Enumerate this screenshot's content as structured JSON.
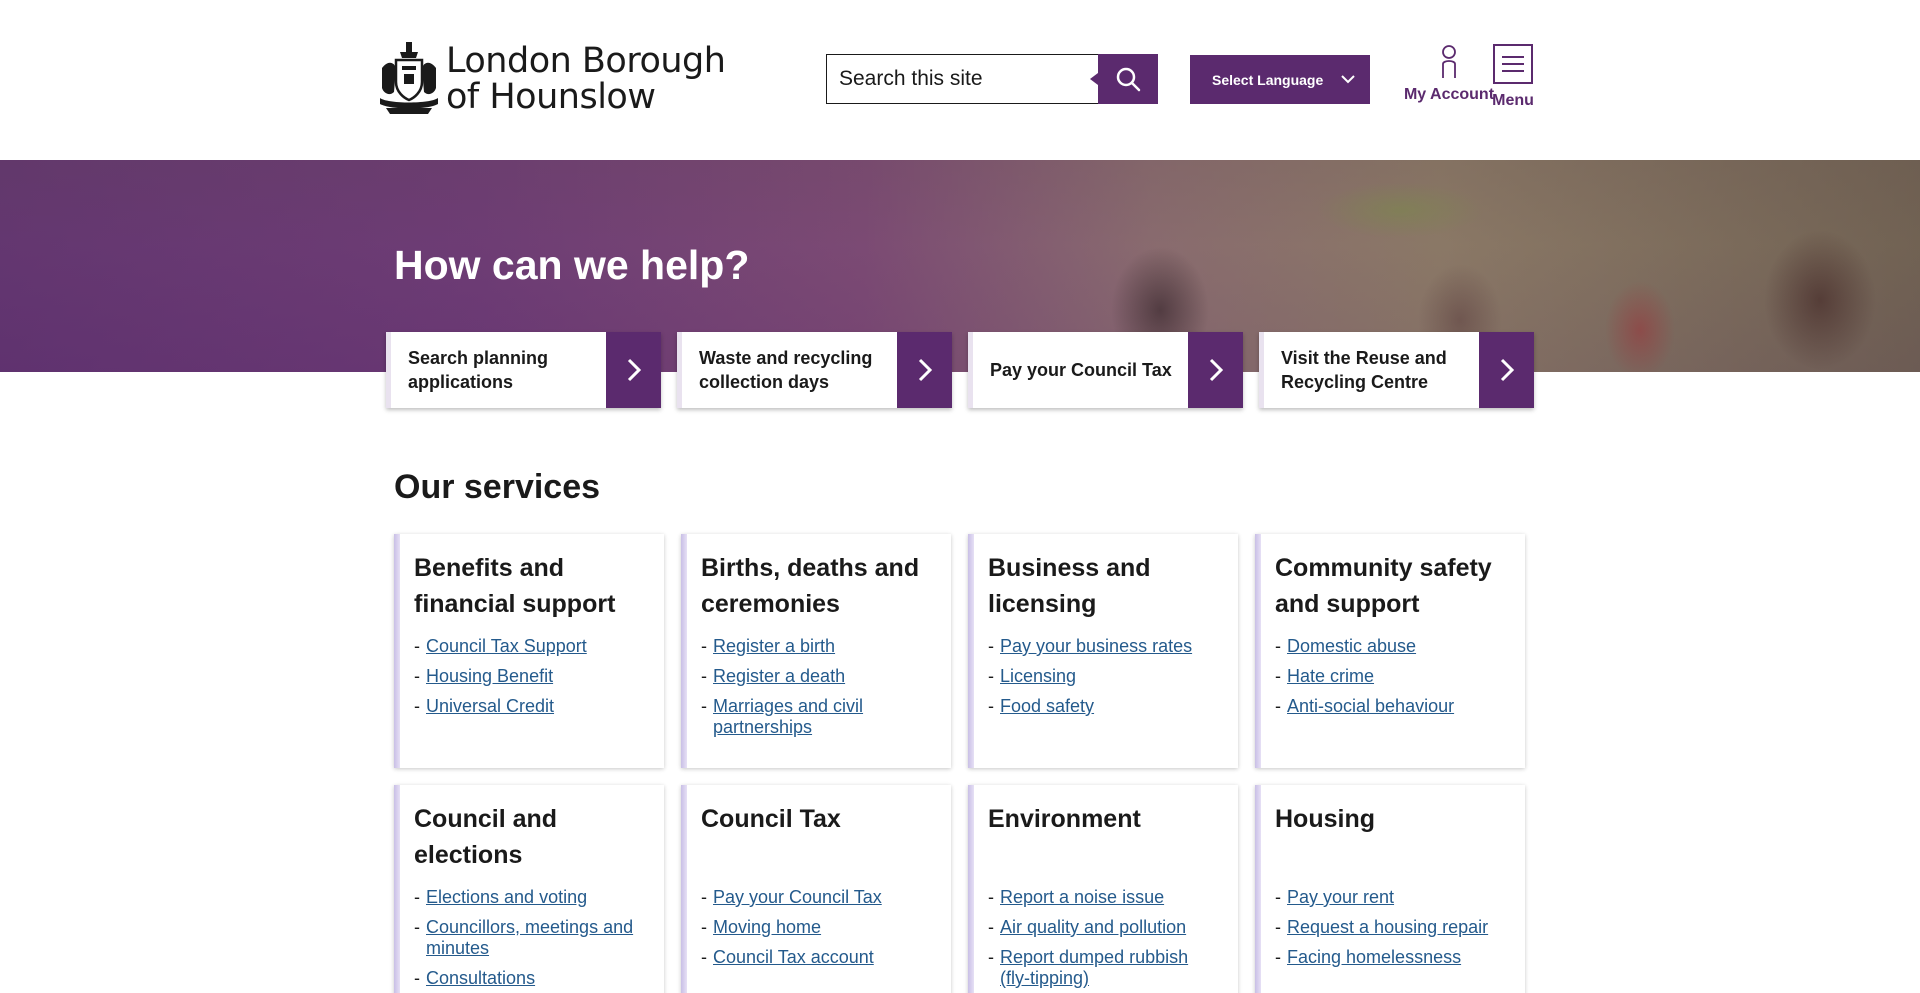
{
  "header": {
    "logo_line1": "London Borough",
    "logo_line2": "of Hounslow",
    "search_placeholder": "Search this site",
    "search_icon": "search-icon",
    "language_label": "Select Language",
    "account_label": "My Account",
    "menu_label": "Menu"
  },
  "colors": {
    "brand_purple": "#5b2a6e",
    "link_blue": "#245a8c",
    "card_accent": "#c9bfe6"
  },
  "hero": {
    "title": "How can we help?"
  },
  "quick_links": [
    {
      "label": "Search planning applications"
    },
    {
      "label": "Waste and recycling collection days"
    },
    {
      "label": "Pay your Council Tax"
    },
    {
      "label": "Visit the Reuse and Recycling Centre"
    }
  ],
  "services": {
    "title": "Our services",
    "cards": [
      {
        "title": "Benefits and financial support",
        "links": [
          "Council Tax Support",
          "Housing Benefit",
          "Universal Credit"
        ]
      },
      {
        "title": "Births, deaths and ceremonies",
        "links": [
          "Register a birth",
          "Register a death",
          "Marriages and civil partnerships"
        ]
      },
      {
        "title": "Business and licensing",
        "links": [
          "Pay your business rates",
          "Licensing",
          "Food safety"
        ]
      },
      {
        "title": "Community safety and support",
        "links": [
          "Domestic abuse",
          "Hate crime",
          "Anti-social behaviour"
        ]
      },
      {
        "title": "Council and elections",
        "links": [
          "Elections and voting",
          "Councillors, meetings and minutes",
          "Consultations"
        ]
      },
      {
        "title": "Council Tax",
        "links": [
          "Pay your Council Tax",
          "Moving home",
          "Council Tax account"
        ]
      },
      {
        "title": "Environment",
        "links": [
          "Report a noise issue",
          "Air quality and pollution",
          "Report dumped rubbish (fly-tipping)"
        ]
      },
      {
        "title": "Housing",
        "links": [
          "Pay your rent",
          "Request a housing repair",
          "Facing homelessness"
        ]
      }
    ]
  }
}
